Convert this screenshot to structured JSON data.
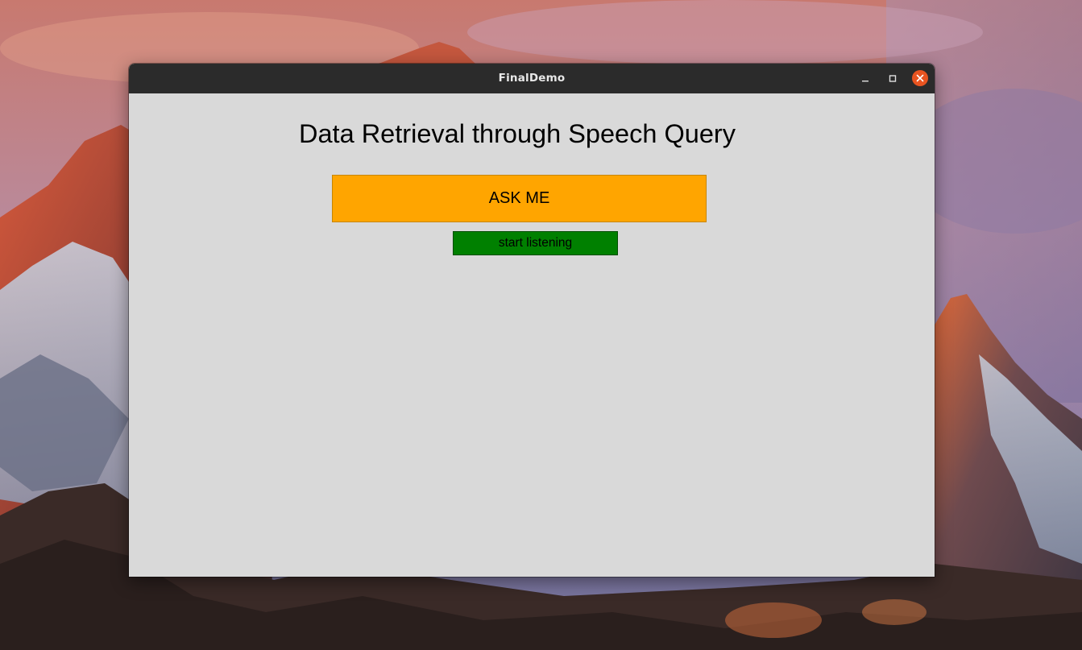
{
  "window": {
    "title": "FinalDemo"
  },
  "app": {
    "heading": "Data Retrieval through Speech Query",
    "ask_button_label": "ASK ME",
    "listen_button_label": "start listening"
  },
  "colors": {
    "ask_button_bg": "#ffa500",
    "listen_button_bg": "#008000",
    "client_bg": "#d9d9d9",
    "titlebar_bg": "#2b2b2b",
    "close_button_bg": "#e95420"
  },
  "icons": {
    "minimize": "minimize-icon",
    "maximize": "maximize-icon",
    "close": "close-icon"
  }
}
